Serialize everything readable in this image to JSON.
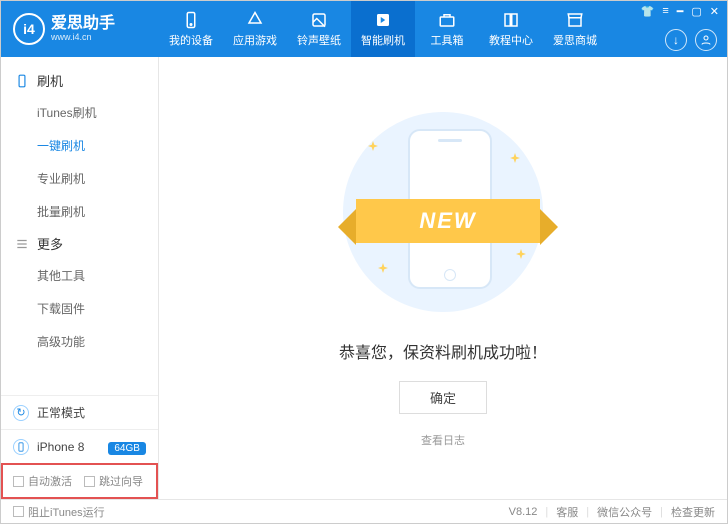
{
  "app": {
    "name": "爱思助手",
    "url": "www.i4.cn",
    "logo_letters": "i4"
  },
  "nav": [
    {
      "label": "我的设备"
    },
    {
      "label": "应用游戏"
    },
    {
      "label": "铃声壁纸"
    },
    {
      "label": "智能刷机",
      "active": true
    },
    {
      "label": "工具箱"
    },
    {
      "label": "教程中心"
    },
    {
      "label": "爱思商城"
    }
  ],
  "sidebar": {
    "flash_header": "刷机",
    "flash_items": [
      {
        "label": "iTunes刷机"
      },
      {
        "label": "一键刷机",
        "active": true
      },
      {
        "label": "专业刷机"
      },
      {
        "label": "批量刷机"
      }
    ],
    "more_header": "更多",
    "more_items": [
      {
        "label": "其他工具"
      },
      {
        "label": "下载固件"
      },
      {
        "label": "高级功能"
      }
    ],
    "mode": "正常模式",
    "device": "iPhone 8",
    "capacity": "64GB",
    "auto_activate": "自动激活",
    "skip_wizard": "跳过向导"
  },
  "main": {
    "ribbon": "NEW",
    "success": "恭喜您，保资料刷机成功啦！",
    "ok": "确定",
    "log": "查看日志"
  },
  "footer": {
    "block_itunes": "阻止iTunes运行",
    "version": "V8.12",
    "support": "客服",
    "wechat": "微信公众号",
    "update": "检查更新"
  }
}
